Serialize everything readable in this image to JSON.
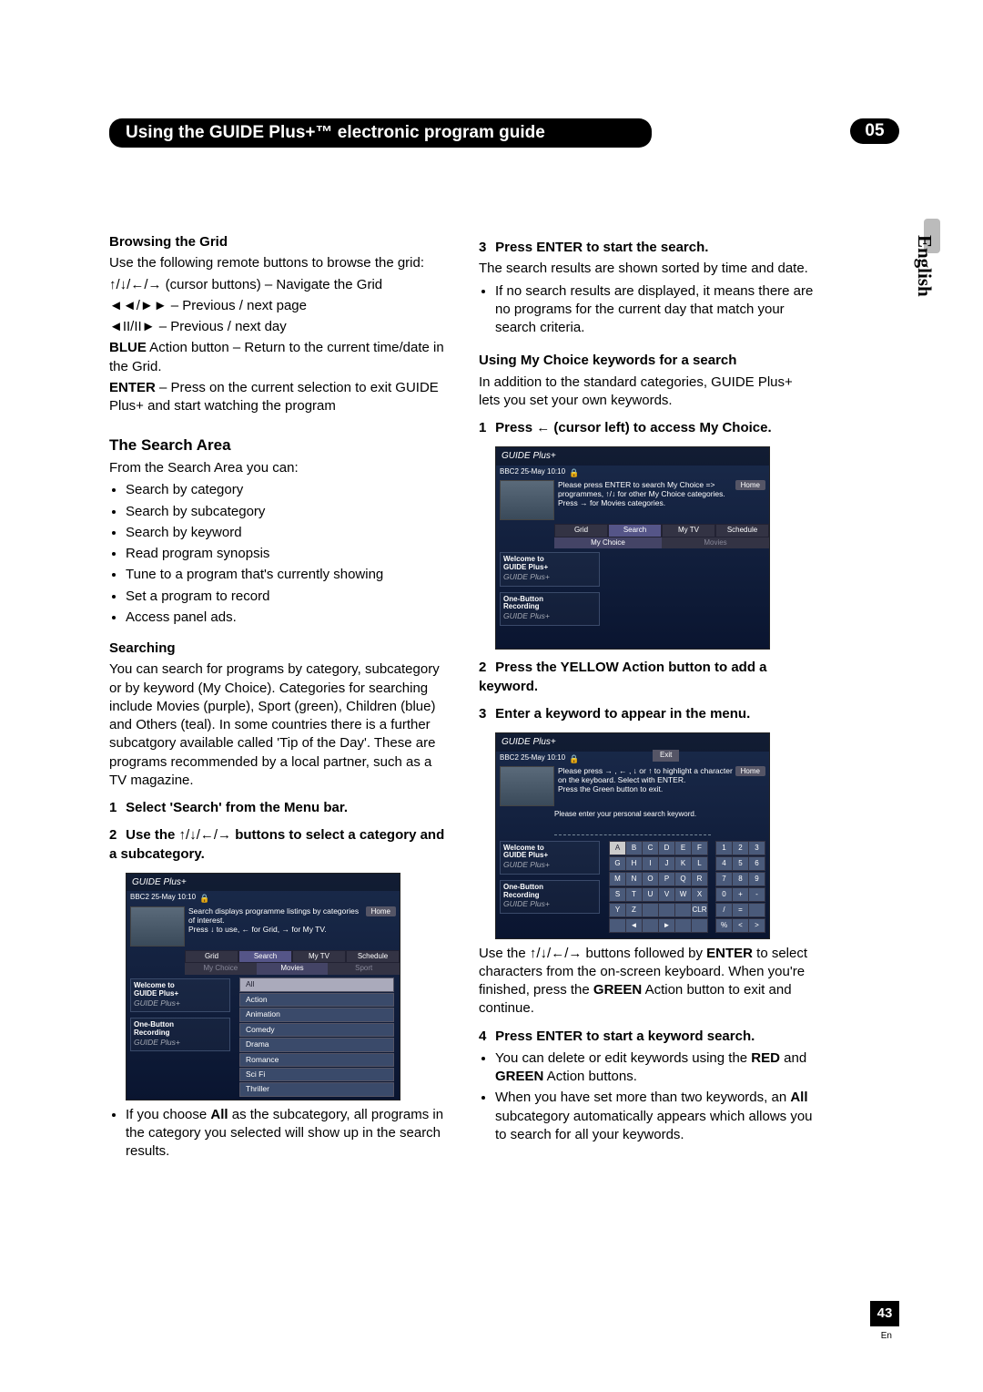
{
  "header": {
    "title": "Using the GUIDE Plus+™ electronic program guide",
    "chapter": "05"
  },
  "side": {
    "language": "English"
  },
  "left": {
    "browsing": {
      "heading": "Browsing the Grid",
      "intro": "Use the following remote buttons to browse the grid:",
      "nav_cursor_suffix": " (cursor buttons) – Navigate the Grid",
      "nav_page": " – Previous / next page",
      "nav_day": " – Previous / next day",
      "blue_label": "BLUE",
      "blue_text": " Action button – Return to the current time/date in the Grid.",
      "enter_label": "ENTER",
      "enter_text": " – Press on the current selection to exit GUIDE Plus+ and start watching the program"
    },
    "search_area": {
      "heading": "The Search Area",
      "intro": "From the Search Area you can:",
      "items": [
        "Search by category",
        "Search by subcategory",
        "Search by keyword",
        "Read program synopsis",
        "Tune to a program that's currently showing",
        "Set a program to record",
        "Access panel ads."
      ]
    },
    "searching": {
      "heading": "Searching",
      "para": "You can search for programs by category, subcategory or by keyword (My Choice). Categories for searching include Movies (purple), Sport (green), Children (blue) and Others (teal). In some countries there is a further subcatgory available called 'Tip of the Day'. These are programs recommended by a local partner, such as a TV magazine.",
      "step1": "Select 'Search' from the Menu bar.",
      "step2_pre": "Use the ",
      "step2_post": " buttons to select a category and a subcategory.",
      "note_pre": "If you choose ",
      "note_bold": "All",
      "note_post": " as the subcategory, all programs in the category you selected will show up in the search results."
    }
  },
  "right": {
    "start_search": {
      "heading": "Press ENTER to start the search.",
      "para": "The search results are shown sorted by time and date.",
      "bullet": "If no search results are displayed, it means there are no programs for the current day that match your search criteria."
    },
    "mychoice": {
      "heading": "Using My Choice keywords for a search",
      "para": "In addition to the standard categories, GUIDE Plus+ lets you set your own keywords.",
      "step1_pre": "Press ",
      "step1_post": " (cursor left) to access My Choice.",
      "step2": "Press the YELLOW Action button to add a keyword.",
      "step3": "Enter a keyword to appear in the menu.",
      "use_pre": "Use the ",
      "use_mid": " buttons followed by ",
      "use_enter": "ENTER",
      "use_post": " to select characters from the on-screen keyboard. When you're finished, press the ",
      "use_green": "GREEN",
      "use_end": " Action button to exit and continue.",
      "step4": "Press ENTER to start a keyword search.",
      "b1_pre": "You can delete or edit keywords using the ",
      "b1_red": "RED",
      "b1_and": " and ",
      "b1_green": "GREEN",
      "b1_post": " Action buttons.",
      "b2_pre": "When you have set more than two keywords, an ",
      "b2_all": "All",
      "b2_post": " subcategory automatically appears which allows you to search for all your keywords."
    }
  },
  "mock1": {
    "logo": "GUIDE Plus+",
    "status": "BBC2   25-May  10:10",
    "home": "Home",
    "info1": "Search displays programme listings by categories of interest.",
    "info2": "Press ↓ to use, ← for Grid, → for My TV.",
    "tabs": [
      "Grid",
      "Search",
      "My TV",
      "Schedule"
    ],
    "subtabs": [
      "My Choice",
      "Movies",
      "Sport"
    ],
    "list": [
      "All",
      "Action",
      "Animation",
      "Comedy",
      "Drama",
      "Romance",
      "Sci Fi",
      "Thriller"
    ],
    "side1_t": "Welcome to",
    "side1_b": "GUIDE Plus+",
    "side2_t": "One-Button",
    "side2_b": "Recording"
  },
  "mock2": {
    "info1": "Please press ENTER to search My Choice => programmes, ↑/↓ for other My Choice categories. Press → for Movies categories.",
    "subtabs": [
      "My Choice",
      "Movies"
    ]
  },
  "mock3": {
    "exit": "Exit",
    "info1": "Please press → , ← , ↓ or ↑ to highlight a character on the keyboard. Select with ENTER.",
    "info2": "Press the Green button to exit.",
    "prompt": "Please enter your personal search keyword.",
    "letters": [
      "A",
      "B",
      "C",
      "D",
      "E",
      "F",
      "G",
      "H",
      "I",
      "J",
      "K",
      "L",
      "M",
      "N",
      "O",
      "P",
      "Q",
      "R",
      "S",
      "T",
      "U",
      "V",
      "W",
      "X",
      "Y",
      "Z",
      " ",
      " ",
      " ",
      "CLR"
    ],
    "nums": [
      "1",
      "2",
      "3",
      "4",
      "5",
      "6",
      "7",
      "8",
      "9",
      "0",
      "+",
      "-",
      "/",
      "=",
      " ",
      "%",
      "<",
      ">"
    ],
    "arrows": [
      " ",
      "◄",
      " ",
      "►",
      " ",
      " "
    ]
  },
  "footer": {
    "page": "43",
    "locale": "En"
  }
}
